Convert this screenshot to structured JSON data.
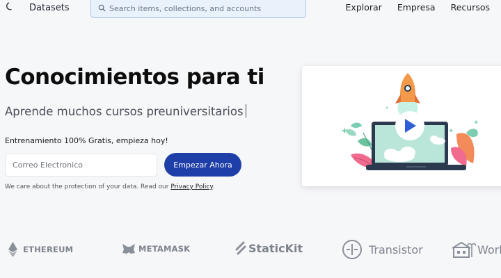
{
  "nav": {
    "brand": "Datasets",
    "search_placeholder": "Search items, collections, and accounts",
    "links": [
      "Explorar",
      "Empresa",
      "Recursos"
    ]
  },
  "hero": {
    "title": "Conocimientos para ti",
    "subtitle": "Aprende muchos cursos preuniversitarios",
    "promo": "Entrenamiento 100% Gratis, empieza hoy!",
    "email_placeholder": "Correo Electronico",
    "cta_label": "Empezar Ahora",
    "privacy_text": "We care about the protection of your data. Read our ",
    "privacy_link": "Privacy Policy",
    "privacy_end": "."
  },
  "logos": [
    "ETHEREUM",
    "METAMASK",
    "StaticKit",
    "Transistor",
    "Work"
  ],
  "icons": {
    "theme": "moon-icon",
    "search": "search-icon",
    "illustration": "rocket-laptop-illustration"
  },
  "colors": {
    "cta": "#1e3ea8",
    "search_bg": "#e9f1fb",
    "page_bg": "#f6f7f9",
    "logo_gray": "#7d838c"
  }
}
